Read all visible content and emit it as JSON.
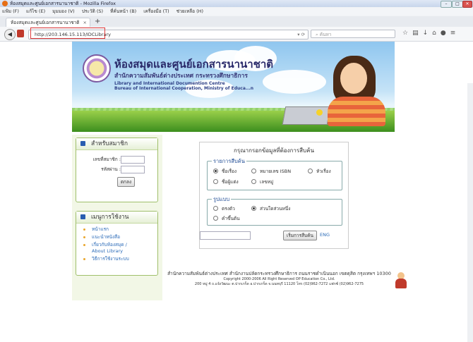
{
  "window": {
    "title": "ห้องสมุดและศูนย์เอกสารนานาชาติ - Mozilla Firefox"
  },
  "menubar": [
    "แฟ้ม (F)",
    "แก้ไข (E)",
    "มุมมอง (V)",
    "ประวัติ (S)",
    "ที่คั่นหน้า (B)",
    "เครื่องมือ (T)",
    "ช่วยเหลือ (H)"
  ],
  "tab": {
    "label": "ห้องสมุดและศูนย์เอกสารนานาชาติ",
    "close": "×",
    "new": "+"
  },
  "nav": {
    "url": "http://203.146.15.113/IDCLibrary",
    "search_placeholder": "ค้นหา"
  },
  "banner": {
    "title_th": "ห้องสมุดและศูนย์เอกสารนานาชาติ",
    "subtitle_th": "สำนักความสัมพันธ์ต่างประเทศ กระทรวงศึกษาธิการ",
    "title_en1": "Library and International Documention Centre",
    "title_en2": "Bureau of International Cooperation, Ministry of Educa...n"
  },
  "member": {
    "heading": "สำหรับสมาชิก",
    "id_label": "เลขที่สมาชิก :",
    "pw_label": "รหัสผ่าน :",
    "login_button": "ตกลง"
  },
  "menu": {
    "heading": "เมนูการใช้งาน",
    "items": [
      "หน้าแรก",
      "แนะนำหนังสือ",
      "เกี่ยวกับห้องสมุด /",
      "About Library",
      "วิธีการใช้งานระบบ"
    ]
  },
  "search": {
    "prompt": "กรุณากรอกข้อมูลที่ต้องการสืบค้น",
    "fieldset1": "รายการสืบค้น",
    "opt_title": "ชื่อเรื่อง",
    "opt_isbn": "หมายเลข ISBN",
    "opt_subject": "หัวเรื่อง",
    "opt_author": "ชื่อผู้แต่ง",
    "opt_callno": "เลขหมู่",
    "fieldset2": "รูปแบบ",
    "opt_exact": "ตรงตัว",
    "opt_partial": "ส่วนใดส่วนหนึ่ง",
    "opt_prefix": "คำขึ้นต้น",
    "button": "เริ่มการสืบค้น",
    "eng": "ENG"
  },
  "footer": {
    "line1": "สำนักความสัมพันธ์ต่างประเทศ สำนักงานปลัดกระทรวงศึกษาธิการ ถนนราชดำเนินนอก เขตดุสิต กรุงเทพฯ 10300",
    "line2": "Copyright 2000-2006 All Right Reserved OP Education Co., Ltd.",
    "line3": "200 หมู่ 4 ถ.แจ้งวัฒนะ ต.ปากเกร็ด อ.ปากเกร็ด จ.นนทบุรี 11120 โทร (02)962-7272 แฟกซ์ (02)962-7275"
  }
}
